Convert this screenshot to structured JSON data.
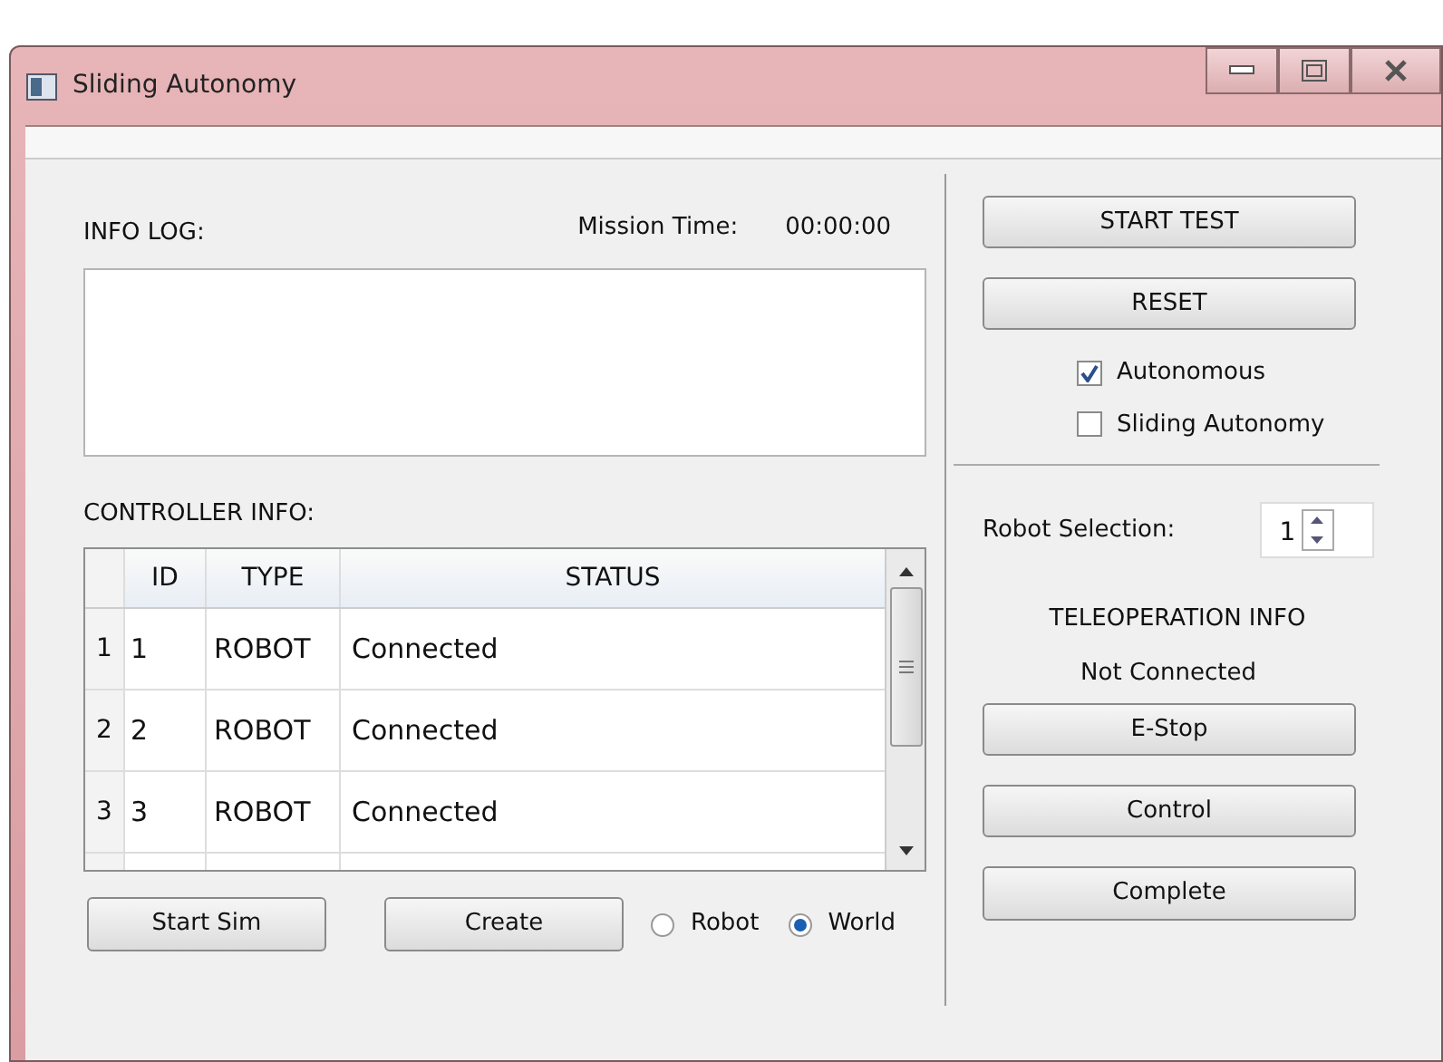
{
  "window": {
    "title": "Sliding Autonomy"
  },
  "info_log": {
    "label": "INFO LOG:",
    "mission_time_label": "Mission Time:",
    "mission_time": "00:00:00"
  },
  "controller_info": {
    "label": "CONTROLLER INFO:",
    "table": {
      "columns": [
        "ID",
        "TYPE",
        "STATUS"
      ],
      "rows": [
        {
          "header": "1",
          "cells": [
            "1",
            "ROBOT",
            "Connected"
          ]
        },
        {
          "header": "2",
          "cells": [
            "2",
            "ROBOT",
            "Connected"
          ]
        },
        {
          "header": "3",
          "cells": [
            "3",
            "ROBOT",
            "Connected"
          ]
        }
      ]
    }
  },
  "bottom_buttons": [
    "Start Sim",
    "Create"
  ],
  "mode_radios": [
    {
      "label": "Robot",
      "selected": false
    },
    {
      "label": "World",
      "selected": true
    }
  ],
  "test_buttons": [
    "START TEST",
    "RESET"
  ],
  "checkboxes": [
    {
      "label": "Autonomous",
      "checked": true
    },
    {
      "label": "Sliding Autonomy",
      "checked": false
    }
  ],
  "robot_selection": {
    "label": "Robot Selection:",
    "value": "1"
  },
  "teleoperation": {
    "title": "TELEOPERATION INFO",
    "status": "Not Connected",
    "buttons": [
      "E-Stop",
      "Control",
      "Complete"
    ]
  }
}
